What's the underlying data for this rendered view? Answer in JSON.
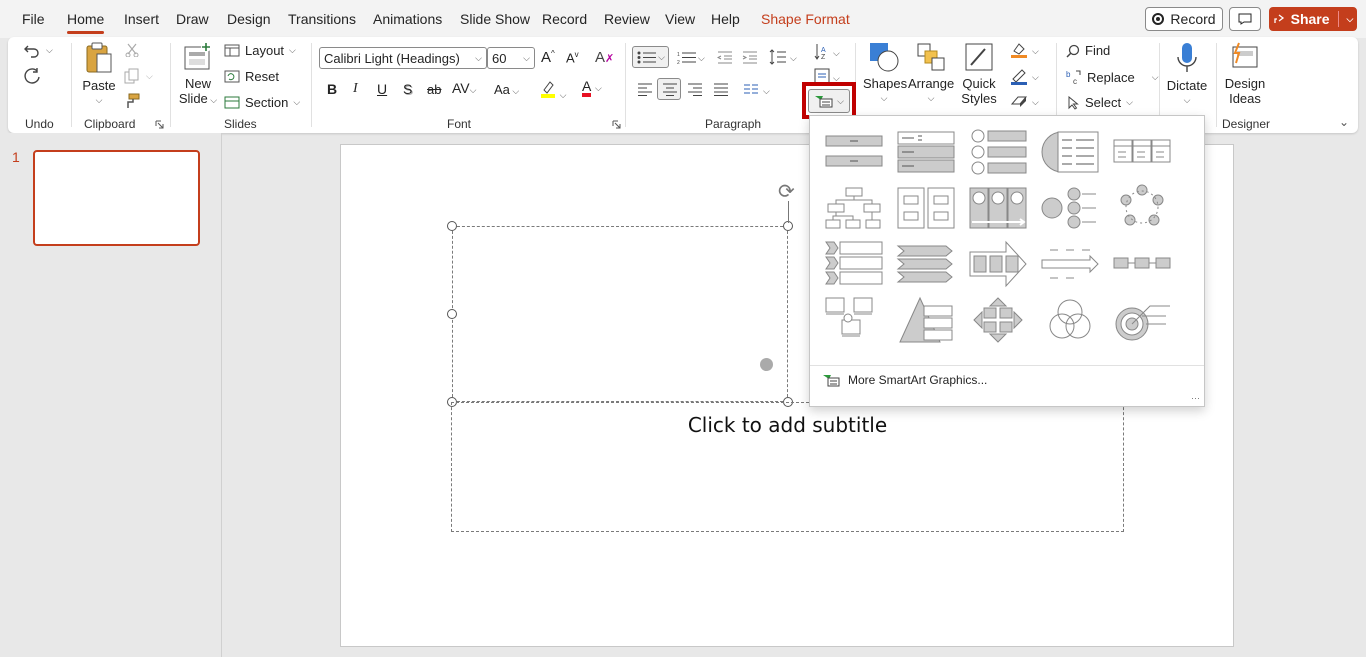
{
  "menu": {
    "tabs": [
      "File",
      "Home",
      "Insert",
      "Draw",
      "Design",
      "Transitions",
      "Animations",
      "Slide Show",
      "Record",
      "Review",
      "View",
      "Help",
      "Shape Format"
    ],
    "record_label": "Record",
    "share_label": "Share"
  },
  "ribbon": {
    "groups": {
      "undo": "Undo",
      "clipboard": "Clipboard",
      "slides": "Slides",
      "font": "Font",
      "paragraph": "Paragraph",
      "designer": "Designer"
    },
    "paste_label": "Paste",
    "new_slide_label": "New\nSlide",
    "new_label": "New",
    "slide_label": "Slide",
    "layout_label": "Layout",
    "reset_label": "Reset",
    "section_label": "Section",
    "font_name": "Calibri Light (Headings)",
    "font_size": "60",
    "shapes_label": "Shapes",
    "arrange_label": "Arrange",
    "quick_label": "Quick",
    "styles_label": "Styles",
    "find_label": "Find",
    "replace_label": "Replace",
    "select_label": "Select",
    "dictate_label": "Dictate",
    "design_label": "Design",
    "ideas_label": "Ideas",
    "bold": "B",
    "italic": "I",
    "underline": "U",
    "strike": "S",
    "strike2": "ab",
    "case": "Aa"
  },
  "thumbnail": {
    "number": "1"
  },
  "slide": {
    "subtitle_placeholder": "Click to add subtitle"
  },
  "gallery": {
    "more_label": "More SmartArt Graphics..."
  },
  "colors": {
    "accent": "#c43e1c",
    "highlight_box": "#c00000",
    "font_color": "#e81123",
    "highlight_color": "#ffff00"
  }
}
